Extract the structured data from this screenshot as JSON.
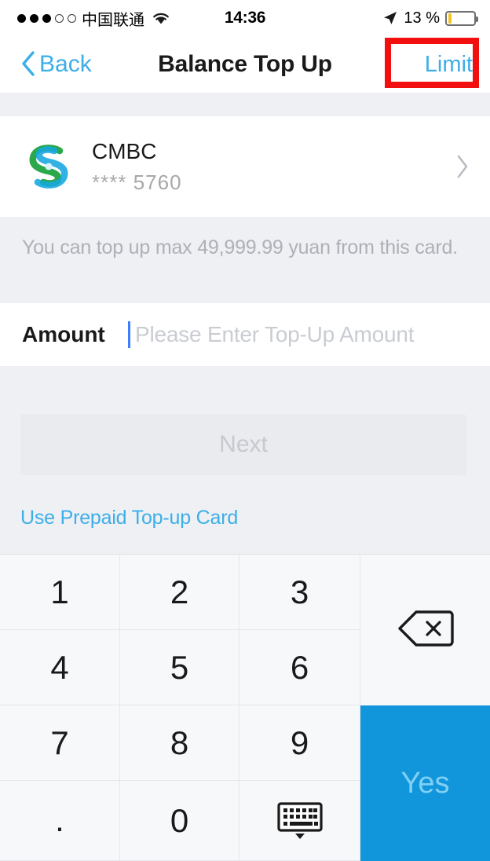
{
  "status_bar": {
    "signal_dots_filled": 3,
    "signal_dots_empty": 2,
    "carrier": "中国联通",
    "wifi_icon": "wifi-icon",
    "time": "14:36",
    "location_icon": "location-arrow-icon",
    "battery_percent": "13 %",
    "battery_level": 13,
    "battery_color": "#f3c623"
  },
  "nav_bar": {
    "back_label": "Back",
    "back_icon": "chevron-left-icon",
    "title": "Balance Top Up",
    "limit_label": "Limit",
    "accent_color": "#3caee8",
    "annotation_color": "#f10f0f"
  },
  "bank_card": {
    "logo_icon": "cmbc-bank-logo",
    "name": "CMBC",
    "masked_number": "**** 5760",
    "chevron_icon": "chevron-right-icon"
  },
  "notice": {
    "text": "You can top up max 49,999.99 yuan from this card."
  },
  "amount": {
    "label": "Amount",
    "value": "",
    "placeholder": "Please Enter Top-Up Amount",
    "caret_color": "#3d7dff"
  },
  "actions": {
    "next_label": "Next",
    "next_enabled": false,
    "prepaid_link_label": "Use Prepaid Top-up Card"
  },
  "keypad": {
    "keys": [
      {
        "label": "1",
        "name": "key-1"
      },
      {
        "label": "2",
        "name": "key-2"
      },
      {
        "label": "3",
        "name": "key-3"
      },
      {
        "label": "4",
        "name": "key-4"
      },
      {
        "label": "5",
        "name": "key-5"
      },
      {
        "label": "6",
        "name": "key-6"
      },
      {
        "label": "7",
        "name": "key-7"
      },
      {
        "label": "8",
        "name": "key-8"
      },
      {
        "label": "9",
        "name": "key-9"
      },
      {
        "label": ".",
        "name": "key-decimal"
      },
      {
        "label": "0",
        "name": "key-0"
      }
    ],
    "hide_keyboard_icon": "keyboard-dismiss-icon",
    "backspace_icon": "backspace-icon",
    "confirm_label": "Yes",
    "confirm_color": "#1296db"
  }
}
